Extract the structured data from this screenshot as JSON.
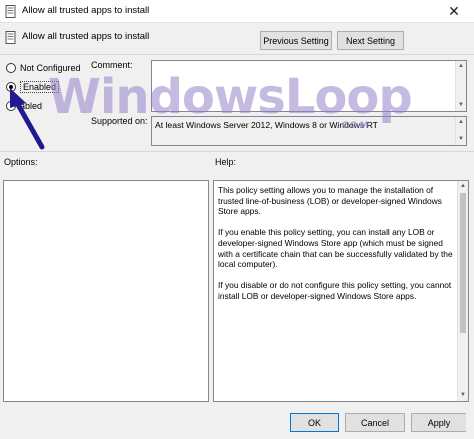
{
  "window": {
    "title": "Allow all trusted apps to install",
    "close_glyph": "✕"
  },
  "header": {
    "title": "Allow all trusted apps to install",
    "previous_label": "Previous Setting",
    "next_label": "Next Setting"
  },
  "state": {
    "options": [
      {
        "label": "Not Configured",
        "selected": false
      },
      {
        "label": "Enabled",
        "selected": true
      },
      {
        "label": "abled",
        "selected": false
      }
    ]
  },
  "comment": {
    "label": "Comment:",
    "value": ""
  },
  "supported": {
    "label": "Supported on:",
    "value": "At least Windows Server 2012, Windows 8 or Windows RT"
  },
  "options_panel": {
    "label": "Options:"
  },
  "help_panel": {
    "label": "Help:",
    "paragraphs": [
      "This policy setting allows you to manage the installation of trusted line-of-business (LOB) or developer-signed Windows Store apps.",
      "If you enable this policy setting, you can install any LOB or developer-signed Windows Store app (which must be signed with a certificate chain that can be successfully validated by the local computer).",
      "If you disable or do not configure this policy setting, you cannot install LOB or developer-signed Windows Store apps."
    ]
  },
  "footer": {
    "ok_label": "OK",
    "cancel_label": "Cancel",
    "apply_label": "Apply"
  },
  "watermark": {
    "text": "WindowsLoop",
    "sub": ".COM"
  },
  "colors": {
    "accent": "#0078d7",
    "arrow": "#1f1a8f",
    "watermark": "#9682c8"
  },
  "icons": {
    "app": "policy-icon",
    "close": "close-icon",
    "arrow": "arrow-annotation"
  }
}
